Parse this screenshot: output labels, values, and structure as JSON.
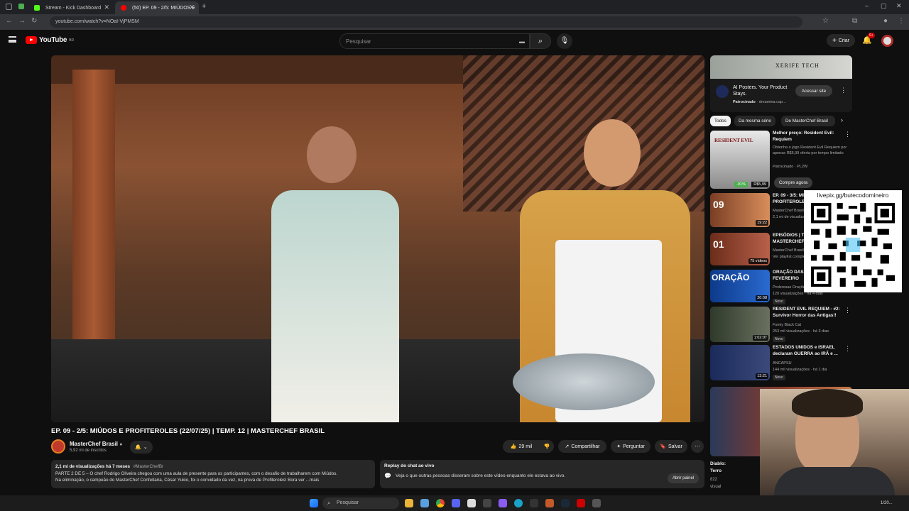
{
  "browser": {
    "tabs": [
      {
        "label": "Stream - Kick Dashboard",
        "favicon_color": "#53fc18"
      },
      {
        "label": "(50) EP. 09 - 2/5: MIÚDOS E",
        "favicon_color": "#ff0000"
      }
    ],
    "url": "youtube.com/watch?v=NOaI-VjPMSM"
  },
  "youtube": {
    "logo": "YouTube",
    "logo_country": "BR",
    "search_placeholder": "Pesquisar",
    "create_label": "Criar",
    "notif_count": "9+"
  },
  "video": {
    "title": "EP. 09 - 2/5: MIÚDOS E PROFITEROLES (22/07/25) | TEMP. 12 | MASTERCHEF BRASIL",
    "channel": "MasterChef Brasil",
    "subscribers": "5,92 mi de inscritos",
    "likes": "29 mil",
    "share_label": "Compartilhar",
    "ask_label": "Perguntar",
    "save_label": "Salvar",
    "views_line": "2,1 mi de visualizações  há 7 meses",
    "hashtag": "#MasterChefBr",
    "description_l1": "PARTE 2 DE 5 – O chef Rodrigo Oliveira chegou com uma aula de presente para os participantes, com o desafio de trabalharem com Miúdos.",
    "description_l2": "Na eliminação, o campeão do MasterChef Confeitaria, César Yukio, foi o convidado da vez, na prova de Profiteroles! Bora ver ...mais",
    "chat_title": "Replay do chat ao vivo",
    "chat_text": "Veja o que outras pessoas disseram sobre este vídeo enquanto ele estava ao vivo.",
    "chat_button": "Abrir painel"
  },
  "ad": {
    "banner_text": "XERIFE TECH",
    "title": "AI Posters. Your Product Stays.",
    "sponsor": "Patrocinado",
    "domain": "dreamina.cap...",
    "button": "Acessar site"
  },
  "chips": [
    "Todos",
    "Da mesma série",
    "De MasterChef Brasil"
  ],
  "sidebar": [
    {
      "title": "Melhor preço: Resident Evil: Requiem",
      "meta1": "Obtenha o jogo Resident Evil Requiem por apenas R$5,99 oferta por tempo limitado",
      "meta2": "Patrocinado · PL2W",
      "badge": "-91%",
      "price": "R$5,99",
      "cta": "Compre agora",
      "thumb_text": "RESIDENT EVIL"
    },
    {
      "title": "EP. 09 - 3/5: MIÚDOS E PROFITEROLES",
      "meta1": "MasterChef Brasil",
      "meta2": "2,1 mi de visualizações",
      "duration": "19:22",
      "thumb_text": "09"
    },
    {
      "title": "EPISÓDIOS | TEMP. 12 (2025) | MASTERCHEF",
      "meta1": "MasterChef Brasil",
      "meta2": "Ver playlist completa",
      "duration": "75 vídeos",
      "thumb_text": "01"
    },
    {
      "title": "ORAÇÃO DAS 12h - DIA 26 DE FEVEREIRO",
      "meta1": "Poderosas Orações",
      "meta2": "120 visualizações · há 4 dias",
      "duration": "20:08",
      "badge": "Novo",
      "thumb_text": "ORAÇÃO"
    },
    {
      "title": "RESIDENT EVIL REQUIEM - #2: Survivor Horror das Antigas!!",
      "meta1": "Funky Black Cat",
      "meta2": "253 mil visualizações · há 3 dias",
      "duration": "1:02:07",
      "badge": "Novo",
      "thumb_text": ""
    },
    {
      "title": "ESTADOS UNIDOS e ISRAEL declaram GUERRA ao IRÃ e ...",
      "meta1": "ANCAPSU",
      "meta2": "144 mil visualizações · há 1 dia",
      "duration": "13:21",
      "badge": "Novo",
      "thumb_text": ""
    },
    {
      "title": "Diablo: Terro",
      "meta1": "822",
      "meta2": "visual",
      "thumb_text": ""
    }
  ],
  "overlay": {
    "qr_label": "livepix.gg/butecodomineiro"
  },
  "taskbar": {
    "search_label": "Pesquisar",
    "clock": "1/20..."
  },
  "colors": {
    "bg": "#0f0f0f",
    "accent_red": "#ff0000",
    "chip_active": "#f1f1f1"
  }
}
